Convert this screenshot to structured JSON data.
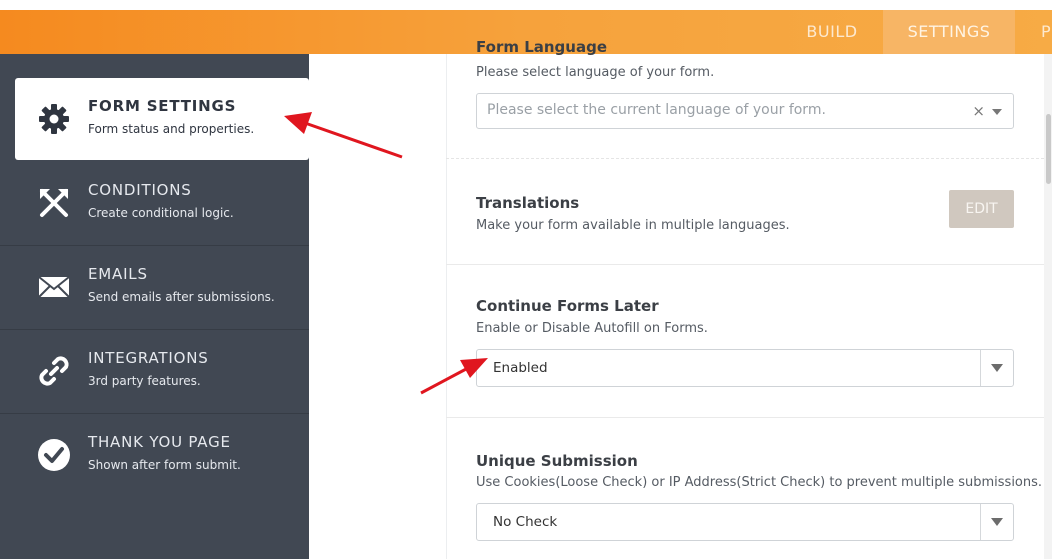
{
  "top_nav": {
    "build": "BUILD",
    "settings": "SETTINGS",
    "publish": "P"
  },
  "sidebar": {
    "items": [
      {
        "title": "FORM SETTINGS",
        "subtitle": "Form status and properties.",
        "icon": "gear-icon",
        "active": true
      },
      {
        "title": "CONDITIONS",
        "subtitle": "Create conditional logic.",
        "icon": "conditions-icon",
        "active": false
      },
      {
        "title": "EMAILS",
        "subtitle": "Send emails after submissions.",
        "icon": "envelope-icon",
        "active": false
      },
      {
        "title": "INTEGRATIONS",
        "subtitle": "3rd party features.",
        "icon": "link-icon",
        "active": false
      },
      {
        "title": "THANK YOU PAGE",
        "subtitle": "Shown after form submit.",
        "icon": "check-circle-icon",
        "active": false
      }
    ]
  },
  "main": {
    "form_language": {
      "title": "Form Language",
      "description": "Please select language of your form.",
      "placeholder": "Please select the current language of your form.",
      "clear_symbol": "×"
    },
    "translations": {
      "title": "Translations",
      "description": "Make your form available in multiple languages.",
      "button": "EDIT"
    },
    "continue_later": {
      "title": "Continue Forms Later",
      "description": "Enable or Disable Autofill on Forms.",
      "value": "Enabled"
    },
    "unique_submission": {
      "title": "Unique Submission",
      "description": "Use Cookies(Loose Check) or IP Address(Strict Check) to prevent multiple submissions.",
      "value": "No Check"
    }
  },
  "colors": {
    "topbar": "#f58a1f",
    "sidebar": "#414853",
    "annotation_arrow": "#e0161f",
    "edit_button": "#d0c8bf"
  }
}
